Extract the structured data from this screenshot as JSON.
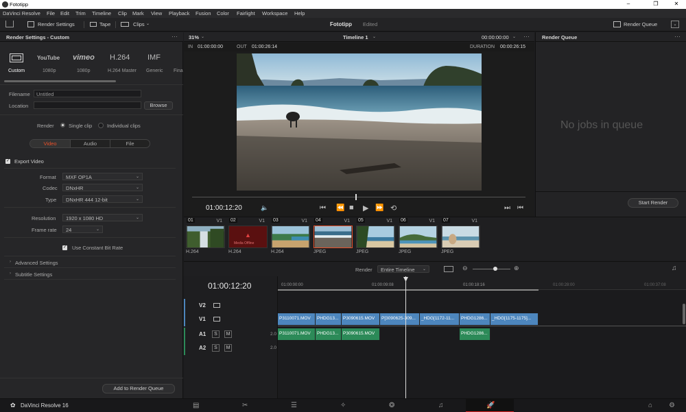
{
  "window": {
    "title": "Fototipp",
    "minimize": "–",
    "maximize": "❐",
    "close": "✕"
  },
  "menu": [
    "DaVinci Resolve",
    "File",
    "Edit",
    "Trim",
    "Timeline",
    "Clip",
    "Mark",
    "View",
    "Playback",
    "Fusion",
    "Color",
    "Fairlight",
    "Workspace",
    "Help"
  ],
  "toolbar": {
    "render_settings": "Render Settings",
    "tape": "Tape",
    "clips": "Clips",
    "project_name": "Fototipp",
    "project_status": "Edited",
    "render_queue": "Render Queue"
  },
  "render_settings": {
    "panel_title": "Render Settings - Custom",
    "presets": [
      {
        "name": "Custom",
        "sub": "Custom",
        "icon": "film-icon"
      },
      {
        "name": "YouTube",
        "sub": "1080p",
        "icon": "youtube-logo"
      },
      {
        "name": "vimeo",
        "sub": "1080p",
        "icon": "vimeo-logo"
      },
      {
        "name": "H.264",
        "sub": "H.264 Master",
        "icon": "h264-text"
      },
      {
        "name": "IMF",
        "sub": "Generic",
        "icon": "imf-text"
      },
      {
        "name": "",
        "sub": "Fina",
        "icon": ""
      }
    ],
    "filename_label": "Filename",
    "filename_value": "Untitled",
    "location_label": "Location",
    "location_value": "",
    "browse": "Browse",
    "render_label": "Render",
    "single_clip": "Single clip",
    "individual_clips": "Individual clips",
    "tabs": [
      "Video",
      "Audio",
      "File"
    ],
    "export_video": "Export Video",
    "format_label": "Format",
    "format_value": "MXF OP1A",
    "codec_label": "Codec",
    "codec_value": "DNxHR",
    "type_label": "Type",
    "type_value": "DNxHR 444 12-bit",
    "resolution_label": "Resolution",
    "resolution_value": "1920 x 1080 HD",
    "framerate_label": "Frame rate",
    "framerate_value": "24",
    "constant_bitrate": "Use Constant Bit Rate",
    "advanced": "Advanced Settings",
    "subtitle": "Subtitle Settings",
    "add_to_queue": "Add to Render Queue"
  },
  "viewer": {
    "zoom": "31%",
    "timeline_name": "Timeline 1",
    "tc_header": "00:00:00:00",
    "in_label": "IN",
    "in_value": "01:00:00:00",
    "out_label": "OUT",
    "out_value": "01:00:26:14",
    "duration_label": "DURATION",
    "duration_value": "00:00:26:15",
    "timecode": "01:00:12:20",
    "playhead": 0.49
  },
  "render_queue": {
    "title": "Render Queue",
    "empty": "No jobs in queue",
    "start": "Start Render"
  },
  "clips": [
    {
      "num": "01",
      "track": "V1",
      "format": "H.264",
      "scene": "waterfall"
    },
    {
      "num": "02",
      "track": "V1",
      "format": "H.264",
      "scene": "offline"
    },
    {
      "num": "03",
      "track": "V1",
      "format": "H.264",
      "scene": "beach-road"
    },
    {
      "num": "04",
      "track": "V1",
      "format": "JPEG",
      "scene": "beach-selected"
    },
    {
      "num": "05",
      "track": "V1",
      "format": "JPEG",
      "scene": "palm-beach"
    },
    {
      "num": "06",
      "track": "V1",
      "format": "JPEG",
      "scene": "coast"
    },
    {
      "num": "07",
      "track": "V1",
      "format": "JPEG",
      "scene": "dog-beach"
    }
  ],
  "offline_text": "Media Offline",
  "timeline": {
    "render_label": "Render",
    "render_value": "Entire Timeline",
    "timecode": "01:00:12:20",
    "ruler": [
      "01:00:00:00",
      "01:00:09:08",
      "01:00:18:16",
      "01:00:28:00",
      "01:00:37:08"
    ],
    "tracks": [
      {
        "name": "V2"
      },
      {
        "name": "V1"
      },
      {
        "name": "A1",
        "level": "2.0"
      },
      {
        "name": "A2",
        "level": "2.0"
      }
    ],
    "solo": "S",
    "mute": "M",
    "video_clips": [
      "P3110071.MOV",
      "PHDG13...",
      "P3090615.MOV",
      "P[3090625-309...",
      "_HDG[1172-11...",
      "PHDG1286...",
      "_HDG[1175-1175]..."
    ],
    "audio_clips": [
      "P3110071.MOV",
      "PHDG13...",
      "P3090615.MOV",
      "PHDG1286..."
    ]
  },
  "bottom": {
    "app_name": "DaVinci Resolve 16",
    "pages": [
      "media-page-icon",
      "cut-page-icon",
      "edit-page-icon",
      "fusion-page-icon",
      "color-page-icon",
      "fairlight-page-icon",
      "deliver-page-icon"
    ]
  }
}
